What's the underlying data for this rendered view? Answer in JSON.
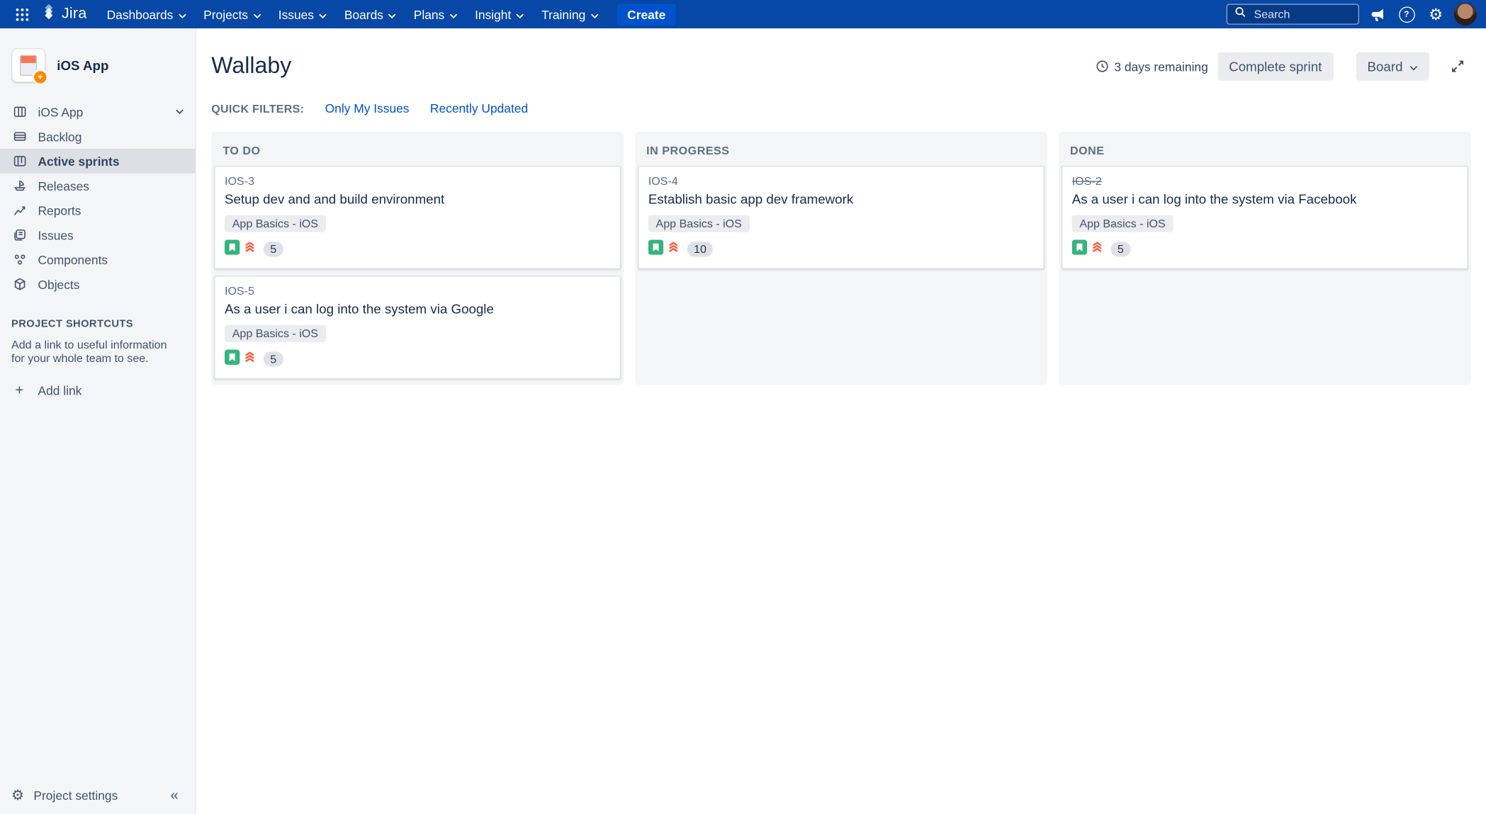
{
  "colors": {
    "navbar": "#0747A6",
    "primary": "#0052CC",
    "story-green": "#36B37E",
    "priority-red": "#FF5630",
    "sidebar-bg": "#F4F5F7",
    "text-dark": "#172B4D",
    "text-mid": "#42526E",
    "text-subtle": "#5E6C84"
  },
  "icons": {
    "gear": "⚙",
    "help": "?",
    "collapse": "«",
    "plus": "+",
    "badge_plus": "+"
  },
  "navbar": {
    "logo_text": "Jira",
    "menu": [
      "Dashboards",
      "Projects",
      "Issues",
      "Boards",
      "Plans",
      "Insight",
      "Training"
    ],
    "create_label": "Create",
    "search_placeholder": "Search"
  },
  "sidebar": {
    "project_name": "iOS App",
    "nav": [
      {
        "label": "iOS App"
      },
      {
        "label": "Backlog"
      },
      {
        "label": "Active sprints"
      },
      {
        "label": "Releases"
      },
      {
        "label": "Reports"
      },
      {
        "label": "Issues"
      },
      {
        "label": "Components"
      },
      {
        "label": "Objects"
      }
    ],
    "shortcuts_heading": "PROJECT SHORTCUTS",
    "shortcuts_description": "Add a link to useful information for your whole team to see.",
    "add_link_label": "Add link",
    "project_settings_label": "Project settings"
  },
  "board": {
    "title": "Wallaby",
    "time_remaining": "3 days remaining",
    "complete_sprint_label": "Complete sprint",
    "view_label": "Board",
    "quick_filters_label": "QUICK FILTERS:",
    "quick_filters": [
      "Only My Issues",
      "Recently Updated"
    ],
    "columns": [
      {
        "name": "TO DO",
        "cards": [
          {
            "key": "IOS-3",
            "summary": "Setup dev and and build environment",
            "epic": "App Basics - iOS",
            "estimate": "5"
          },
          {
            "key": "IOS-5",
            "summary": "As a user i can log into the system via Google",
            "epic": "App Basics - iOS",
            "estimate": "5"
          }
        ]
      },
      {
        "name": "IN PROGRESS",
        "cards": [
          {
            "key": "IOS-4",
            "summary": "Establish basic app dev framework",
            "epic": "App Basics - iOS",
            "estimate": "10"
          }
        ]
      },
      {
        "name": "DONE",
        "cards": [
          {
            "key": "IOS-2",
            "summary": "As a user i can log into the system via Facebook",
            "epic": "App Basics - iOS",
            "estimate": "5"
          }
        ]
      }
    ]
  }
}
